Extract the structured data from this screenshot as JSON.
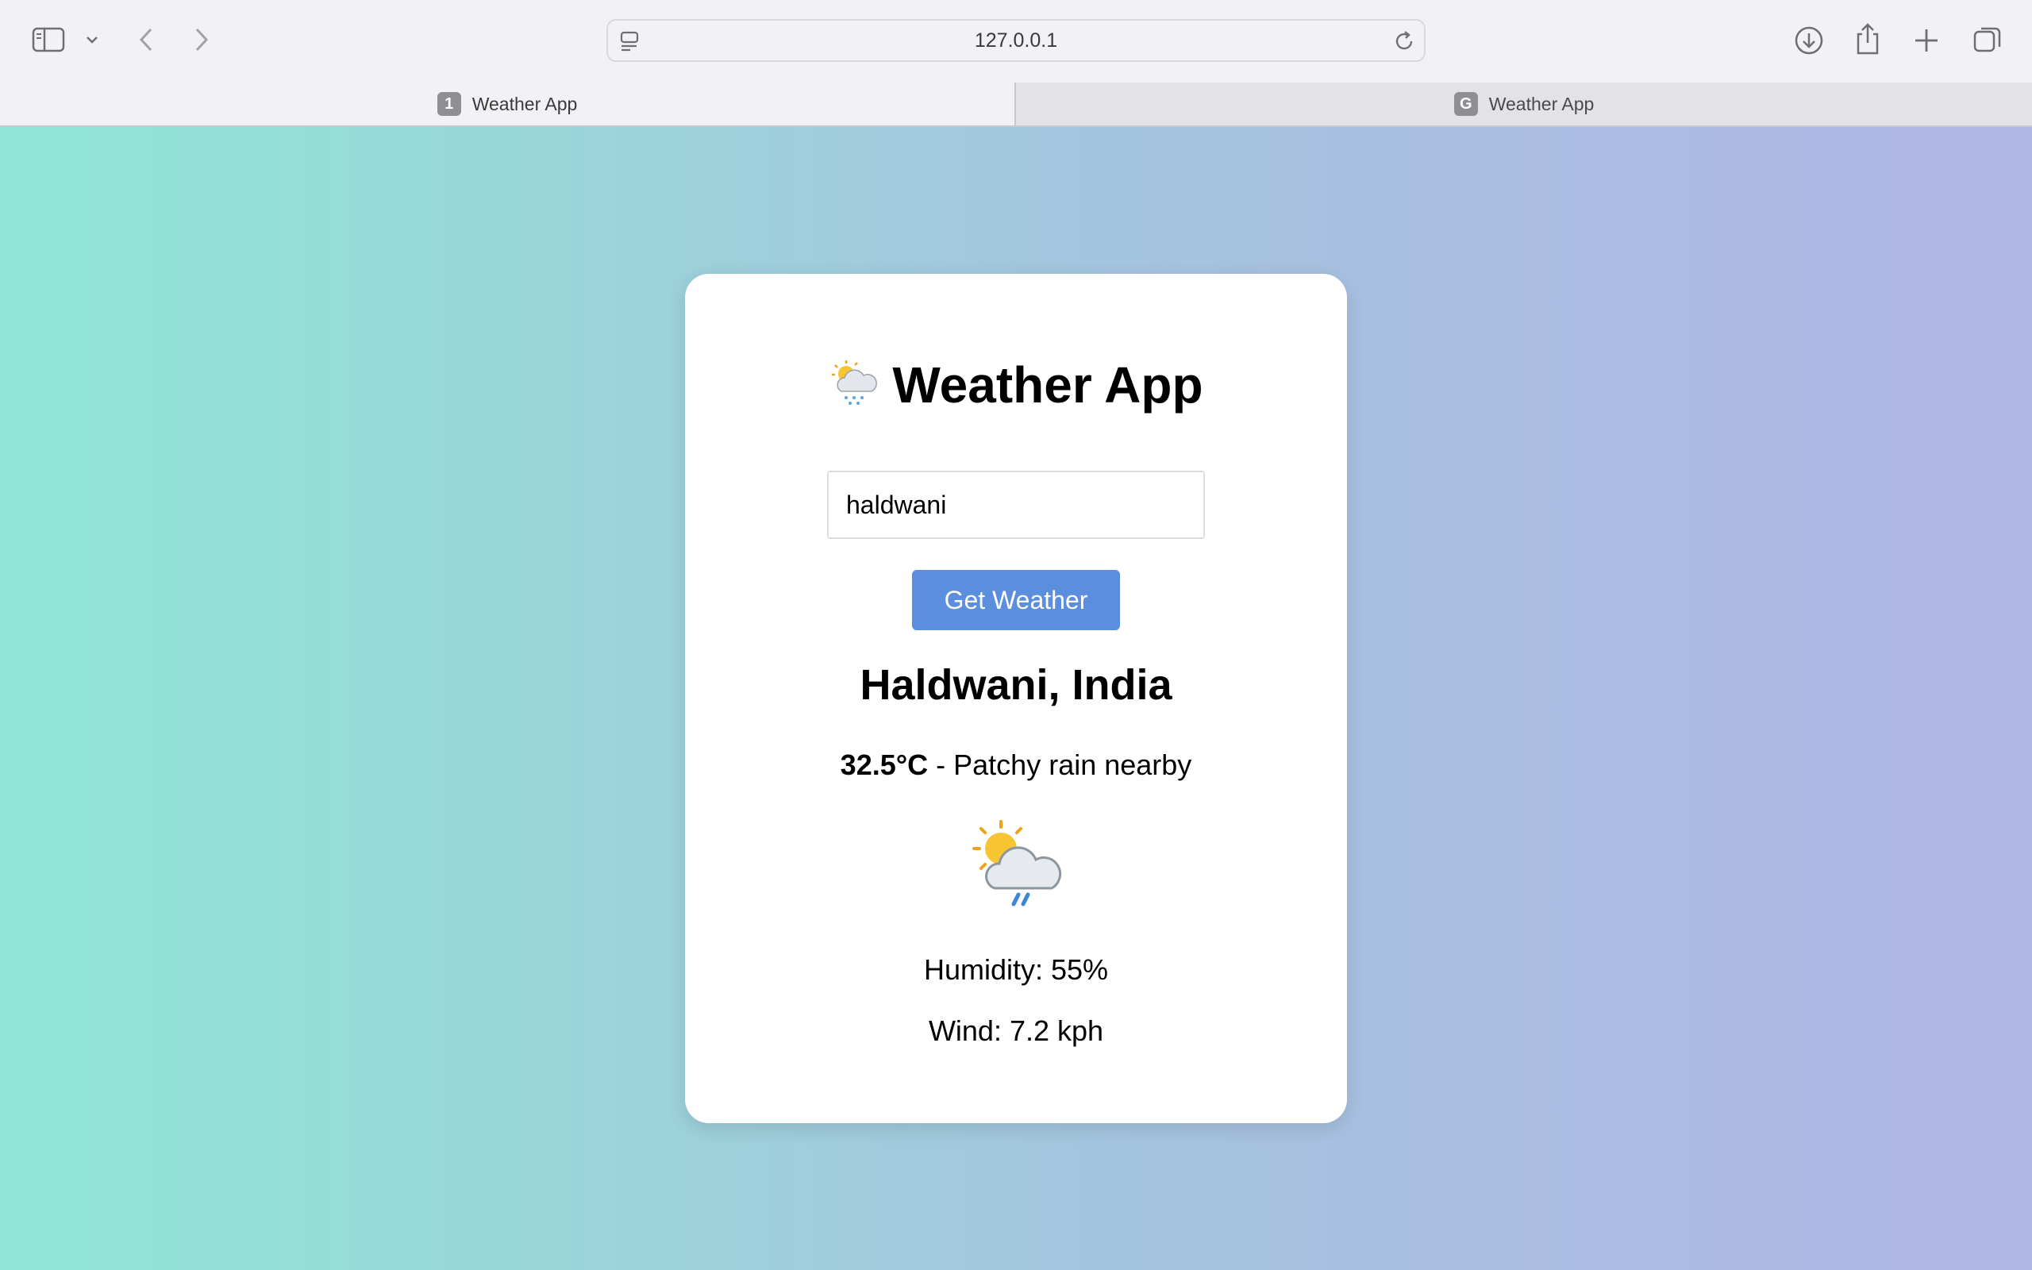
{
  "browser": {
    "url": "127.0.0.1",
    "tabs": [
      {
        "label": "Weather App",
        "badge": "1",
        "active": true
      },
      {
        "label": "Weather App",
        "badge": "G",
        "active": false
      }
    ]
  },
  "app": {
    "title": "Weather App",
    "title_icon": "sun-behind-rain-cloud-icon",
    "search": {
      "value": "haldwani",
      "placeholder": ""
    },
    "button_label": "Get Weather",
    "location": "Haldwani, India",
    "temperature": "32.5°C",
    "condition_separator": " - ",
    "condition": "Patchy rain nearby",
    "condition_icon": "patchy-rain-icon",
    "humidity": "Humidity: 55%",
    "wind": "Wind: 7.2 kph"
  },
  "colors": {
    "button": "#5b8fde",
    "gradient_left": "#8fe6d6",
    "gradient_right": "#afb5e5"
  }
}
